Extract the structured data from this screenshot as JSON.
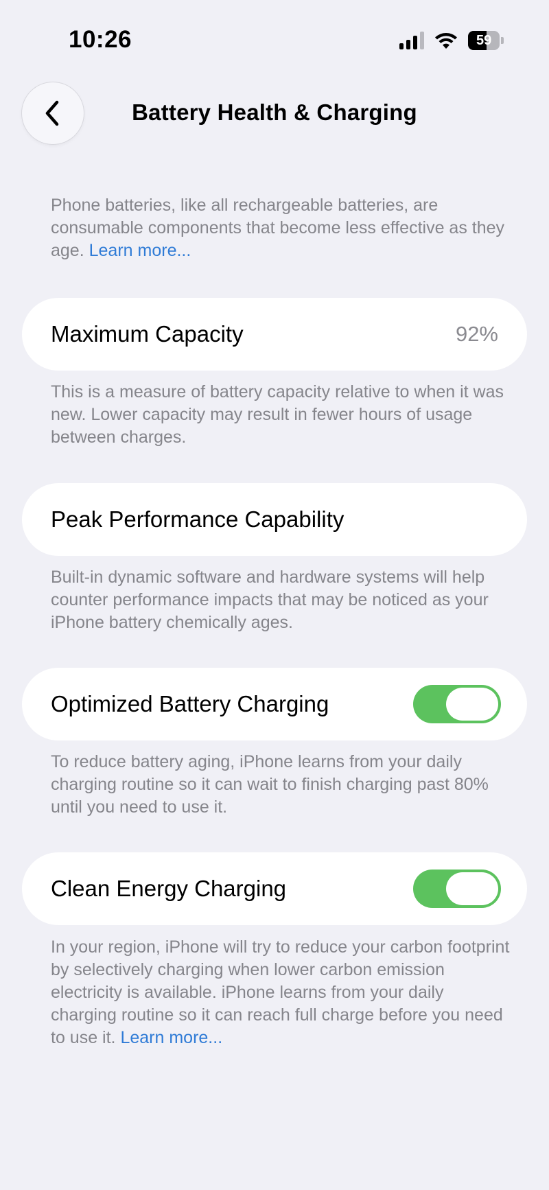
{
  "status_bar": {
    "time": "10:26",
    "battery_level": "59",
    "battery_fraction": 0.59,
    "signal_bars_active": 3,
    "signal_bars_total": 4,
    "wifi": "wifi-icon"
  },
  "nav": {
    "back_icon": "chevron-left-icon",
    "title": "Battery Health & Charging"
  },
  "intro": {
    "text": "Phone batteries, like all rechargeable batteries, are consumable components that become less effective as they age.",
    "link": "Learn more..."
  },
  "maximum_capacity": {
    "label": "Maximum Capacity",
    "value": "92%",
    "footer": "This is a measure of battery capacity relative to when it was new. Lower capacity may result in fewer hours of usage between charges."
  },
  "peak_performance": {
    "label": "Peak Performance Capability",
    "footer": "Built-in dynamic software and hardware systems will help counter performance impacts that may be noticed as your iPhone battery chemically ages."
  },
  "optimized_charging": {
    "label": "Optimized Battery Charging",
    "enabled": true,
    "footer": "To reduce battery aging, iPhone learns from your daily charging routine so it can wait to finish charging past 80% until you need to use it."
  },
  "clean_energy": {
    "label": "Clean Energy Charging",
    "enabled": true,
    "footer": "In your region, iPhone will try to reduce your carbon footprint by selectively charging when lower carbon emission electricity is available. iPhone learns from your daily charging routine so it can reach full charge before you need to use it.",
    "link": "Learn more..."
  },
  "colors": {
    "background": "#f0f0f6",
    "card": "#ffffff",
    "toggle_on": "#5cc25e",
    "link": "#2f7bd6",
    "secondary_text": "#85858b"
  }
}
